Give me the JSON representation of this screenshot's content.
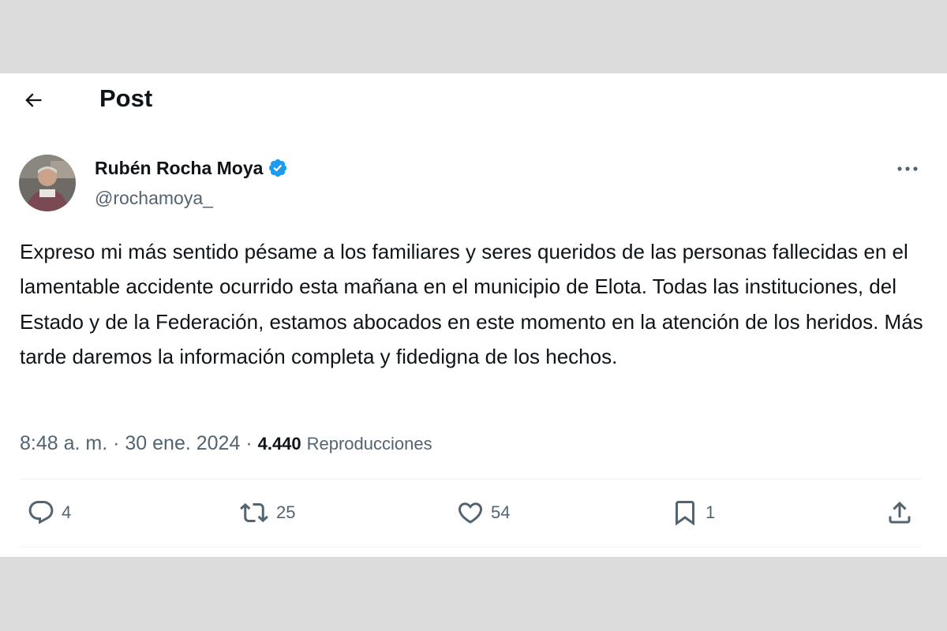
{
  "header": {
    "title": "Post"
  },
  "author": {
    "name": "Rubén Rocha Moya",
    "handle": "@rochamoya_"
  },
  "post": {
    "text": "Expreso mi más sentido pésame a los familiares y seres queridos de las personas fallecidas en el lamentable accidente ocurrido esta mañana en el municipio de Elota. Todas las instituciones, del Estado y de la Federación, estamos abocados en este momento en la atención de los heridos. Más tarde daremos la información completa y fidedigna de los hechos."
  },
  "meta": {
    "time": "8:48 a. m.",
    "date": "30 ene. 2024",
    "separator": " · ",
    "views": "4.440",
    "views_label": "Reproducciones"
  },
  "actions": {
    "replies": "4",
    "reposts": "25",
    "likes": "54",
    "bookmarks": "1"
  },
  "colors": {
    "background": "#dcdcdc",
    "card": "#ffffff",
    "text": "#0f1419",
    "secondary": "#536471",
    "verified": "#1d9bf0",
    "divider": "#eff3f4"
  },
  "icons": [
    "back-arrow-icon",
    "verified-badge-icon",
    "more-icon",
    "reply-icon",
    "repost-icon",
    "like-icon",
    "bookmark-icon",
    "share-icon"
  ]
}
